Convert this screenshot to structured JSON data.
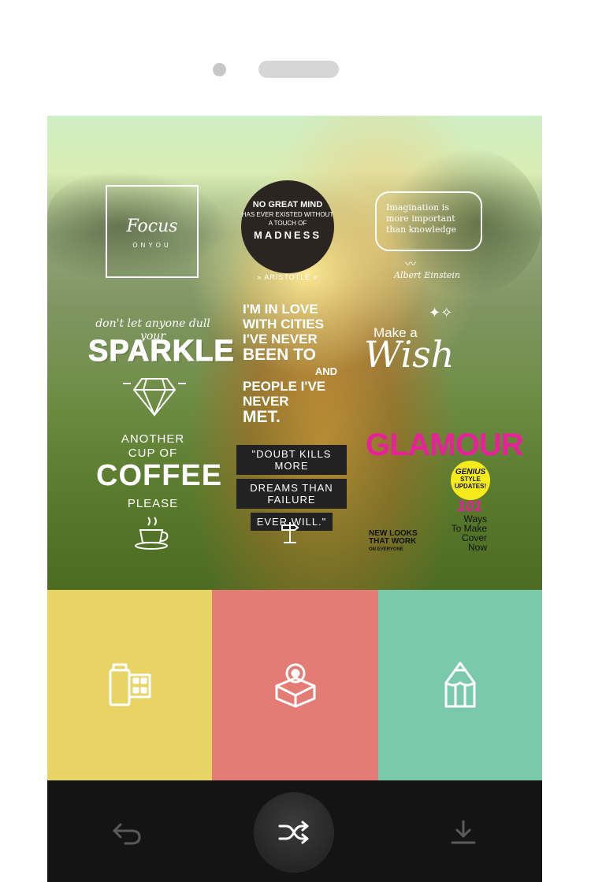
{
  "device": {
    "sensor": "front-camera",
    "speaker": "earpiece"
  },
  "stickers": {
    "focus": {
      "title": "Focus",
      "subtitle": "ONYOU"
    },
    "madness": {
      "line1": "NO GREAT MIND",
      "line2": "HAS EVER EXISTED WITHOUT",
      "line3": "A TOUCH OF",
      "line4": "MADNESS",
      "author": "» ARISTOTLE «"
    },
    "einstein": {
      "quote": "Imagination is more important than knowledge",
      "author": "Albert Einstein"
    },
    "sparkle": {
      "small": "don't let anyone dull your",
      "big": "SPARKLE"
    },
    "cities": {
      "l1": "I'M IN LOVE",
      "l2": "WITH CITIES",
      "l3": "I'VE NEVER",
      "l4": "BEEN TO",
      "l5": "AND",
      "l6": "PEOPLE I'VE",
      "l7": "NEVER",
      "l8": "MET."
    },
    "wish": {
      "make": "Make a",
      "big": "Wish"
    },
    "coffee": {
      "l1": "ANOTHER",
      "l2": "CUP OF",
      "big": "COFFEE",
      "l3": "PLEASE"
    },
    "doubt": {
      "l1": "\"DOUBT KILLS MORE",
      "l2": "DREAMS THAN FAILURE",
      "l3": "EVER WILL.\""
    },
    "glamour": {
      "title": "GLAMOUR",
      "badge1": "GENIUS",
      "badge2": "STYLE UPDATES!",
      "num": "101",
      "ways1": "Ways",
      "ways2": "To Make",
      "ways3": "Cover",
      "ways4": "Now",
      "looks1": "NEW LOOKS",
      "looks2": "THAT WORK",
      "looks3": "ON EVERYONE"
    }
  },
  "tiles": [
    {
      "icon": "film-roll-icon",
      "color": "#e8d365"
    },
    {
      "icon": "sticker-box-icon",
      "color": "#e47c76"
    },
    {
      "icon": "pencil-icon",
      "color": "#7ac9ad"
    }
  ],
  "toolbar": {
    "undo_icon": "undo-icon",
    "shuffle_icon": "shuffle-icon",
    "download_icon": "download-icon",
    "background": "#141414"
  }
}
